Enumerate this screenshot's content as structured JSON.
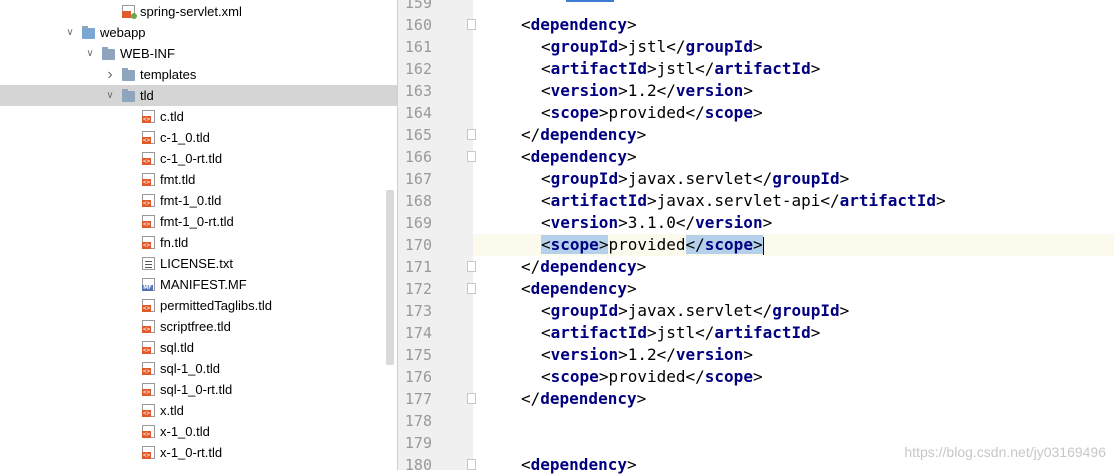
{
  "project_tree": {
    "items": [
      {
        "label": "spring-servlet.xml",
        "icon": "xml-file-icon",
        "depth": 3,
        "arrow": ""
      },
      {
        "label": "webapp",
        "icon": "web-folder-icon",
        "depth": 1,
        "arrow": "expanded"
      },
      {
        "label": "WEB-INF",
        "icon": "folder-icon",
        "depth": 2,
        "arrow": "expanded"
      },
      {
        "label": "templates",
        "icon": "folder-icon",
        "depth": 3,
        "arrow": "collapsed"
      },
      {
        "label": "tld",
        "icon": "folder-icon",
        "depth": 3,
        "arrow": "expanded",
        "selected": true
      },
      {
        "label": "c.tld",
        "icon": "tld-file-icon",
        "depth": 4,
        "arrow": ""
      },
      {
        "label": "c-1_0.tld",
        "icon": "tld-file-icon",
        "depth": 4,
        "arrow": ""
      },
      {
        "label": "c-1_0-rt.tld",
        "icon": "tld-file-icon",
        "depth": 4,
        "arrow": ""
      },
      {
        "label": "fmt.tld",
        "icon": "tld-file-icon",
        "depth": 4,
        "arrow": ""
      },
      {
        "label": "fmt-1_0.tld",
        "icon": "tld-file-icon",
        "depth": 4,
        "arrow": ""
      },
      {
        "label": "fmt-1_0-rt.tld",
        "icon": "tld-file-icon",
        "depth": 4,
        "arrow": ""
      },
      {
        "label": "fn.tld",
        "icon": "tld-file-icon",
        "depth": 4,
        "arrow": ""
      },
      {
        "label": "LICENSE.txt",
        "icon": "text-file-icon",
        "depth": 4,
        "arrow": ""
      },
      {
        "label": "MANIFEST.MF",
        "icon": "manifest-file-icon",
        "depth": 4,
        "arrow": ""
      },
      {
        "label": "permittedTaglibs.tld",
        "icon": "tld-file-icon",
        "depth": 4,
        "arrow": ""
      },
      {
        "label": "scriptfree.tld",
        "icon": "tld-file-icon",
        "depth": 4,
        "arrow": ""
      },
      {
        "label": "sql.tld",
        "icon": "tld-file-icon",
        "depth": 4,
        "arrow": ""
      },
      {
        "label": "sql-1_0.tld",
        "icon": "tld-file-icon",
        "depth": 4,
        "arrow": ""
      },
      {
        "label": "sql-1_0-rt.tld",
        "icon": "tld-file-icon",
        "depth": 4,
        "arrow": ""
      },
      {
        "label": "x.tld",
        "icon": "tld-file-icon",
        "depth": 4,
        "arrow": ""
      },
      {
        "label": "x-1_0.tld",
        "icon": "tld-file-icon",
        "depth": 4,
        "arrow": ""
      },
      {
        "label": "x-1_0-rt.tld",
        "icon": "tld-file-icon",
        "depth": 4,
        "arrow": ""
      }
    ]
  },
  "editor": {
    "lines": [
      {
        "n": "159",
        "parts": []
      },
      {
        "n": "160",
        "fold": true,
        "parts": [
          [
            "t",
            "<"
          ],
          [
            "g",
            "dependency"
          ],
          [
            "t",
            ">"
          ]
        ],
        "indent": 0
      },
      {
        "n": "161",
        "parts": [
          [
            "t",
            "<"
          ],
          [
            "g",
            "groupId"
          ],
          [
            "t",
            ">jstl</"
          ],
          [
            "g",
            "groupId"
          ],
          [
            "t",
            ">"
          ]
        ],
        "indent": 1
      },
      {
        "n": "162",
        "parts": [
          [
            "t",
            "<"
          ],
          [
            "g",
            "artifactId"
          ],
          [
            "t",
            ">jstl</"
          ],
          [
            "g",
            "artifactId"
          ],
          [
            "t",
            ">"
          ]
        ],
        "indent": 1
      },
      {
        "n": "163",
        "parts": [
          [
            "t",
            "<"
          ],
          [
            "g",
            "version"
          ],
          [
            "t",
            ">1.2</"
          ],
          [
            "g",
            "version"
          ],
          [
            "t",
            ">"
          ]
        ],
        "indent": 1
      },
      {
        "n": "164",
        "parts": [
          [
            "t",
            "<"
          ],
          [
            "g",
            "scope"
          ],
          [
            "t",
            ">provided</"
          ],
          [
            "g",
            "scope"
          ],
          [
            "t",
            ">"
          ]
        ],
        "indent": 1
      },
      {
        "n": "165",
        "fold": true,
        "parts": [
          [
            "t",
            "</"
          ],
          [
            "g",
            "dependency"
          ],
          [
            "t",
            ">"
          ]
        ],
        "indent": 0
      },
      {
        "n": "166",
        "fold": true,
        "parts": [
          [
            "t",
            "<"
          ],
          [
            "g",
            "dependency"
          ],
          [
            "t",
            ">"
          ]
        ],
        "indent": 0
      },
      {
        "n": "167",
        "parts": [
          [
            "t",
            "<"
          ],
          [
            "g",
            "groupId"
          ],
          [
            "t",
            ">javax.servlet</"
          ],
          [
            "g",
            "groupId"
          ],
          [
            "t",
            ">"
          ]
        ],
        "indent": 1
      },
      {
        "n": "168",
        "parts": [
          [
            "t",
            "<"
          ],
          [
            "g",
            "artifactId"
          ],
          [
            "t",
            ">javax.servlet-api</"
          ],
          [
            "g",
            "artifactId"
          ],
          [
            "t",
            ">"
          ]
        ],
        "indent": 1
      },
      {
        "n": "169",
        "parts": [
          [
            "t",
            "<"
          ],
          [
            "g",
            "version"
          ],
          [
            "t",
            ">3.1.0</"
          ],
          [
            "g",
            "version"
          ],
          [
            "t",
            ">"
          ]
        ],
        "indent": 1
      },
      {
        "n": "170",
        "current": true,
        "parts": [
          [
            "h",
            "<"
          ],
          [
            "hg",
            "scope"
          ],
          [
            "h",
            ">"
          ],
          [
            "t",
            "provided"
          ],
          [
            "h",
            "</"
          ],
          [
            "hg",
            "scope"
          ],
          [
            "h",
            ">"
          ],
          [
            "c",
            ""
          ]
        ],
        "indent": 1
      },
      {
        "n": "171",
        "fold": true,
        "parts": [
          [
            "t",
            "</"
          ],
          [
            "g",
            "dependency"
          ],
          [
            "t",
            ">"
          ]
        ],
        "indent": 0
      },
      {
        "n": "172",
        "fold": true,
        "parts": [
          [
            "t",
            "<"
          ],
          [
            "g",
            "dependency"
          ],
          [
            "t",
            ">"
          ]
        ],
        "indent": 0
      },
      {
        "n": "173",
        "parts": [
          [
            "t",
            "<"
          ],
          [
            "g",
            "groupId"
          ],
          [
            "t",
            ">javax.servlet</"
          ],
          [
            "g",
            "groupId"
          ],
          [
            "t",
            ">"
          ]
        ],
        "indent": 1
      },
      {
        "n": "174",
        "parts": [
          [
            "t",
            "<"
          ],
          [
            "g",
            "artifactId"
          ],
          [
            "t",
            ">jstl</"
          ],
          [
            "g",
            "artifactId"
          ],
          [
            "t",
            ">"
          ]
        ],
        "indent": 1
      },
      {
        "n": "175",
        "parts": [
          [
            "t",
            "<"
          ],
          [
            "g",
            "version"
          ],
          [
            "t",
            ">1.2</"
          ],
          [
            "g",
            "version"
          ],
          [
            "t",
            ">"
          ]
        ],
        "indent": 1
      },
      {
        "n": "176",
        "parts": [
          [
            "t",
            "<"
          ],
          [
            "g",
            "scope"
          ],
          [
            "t",
            ">provided</"
          ],
          [
            "g",
            "scope"
          ],
          [
            "t",
            ">"
          ]
        ],
        "indent": 1
      },
      {
        "n": "177",
        "fold": true,
        "parts": [
          [
            "t",
            "</"
          ],
          [
            "g",
            "dependency"
          ],
          [
            "t",
            ">"
          ]
        ],
        "indent": 0
      },
      {
        "n": "178",
        "parts": []
      },
      {
        "n": "179",
        "parts": []
      },
      {
        "n": "180",
        "fold": true,
        "parts": [
          [
            "t",
            "<"
          ],
          [
            "g",
            "dependency"
          ],
          [
            "t",
            ">"
          ]
        ],
        "indent": 0
      }
    ]
  },
  "watermark": "https://blog.csdn.net/jy03169496",
  "colors": {
    "tag": "#000080",
    "selection": "#b4d0ea",
    "current_line": "#fcfaed",
    "tree_selected": "#d5d5d5"
  }
}
